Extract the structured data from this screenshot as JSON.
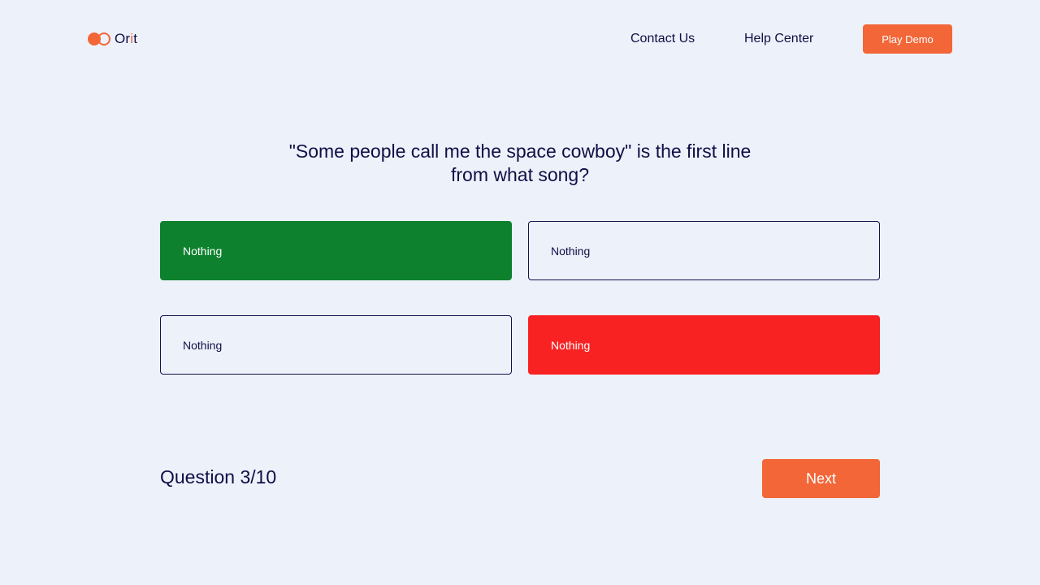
{
  "brand": {
    "name_start": "Or",
    "name_accent": "i",
    "name_end": "t",
    "accent_color": "#f26638"
  },
  "nav": {
    "contact_label": "Contact Us",
    "help_label": "Help Center",
    "demo_label": "Play Demo"
  },
  "quiz": {
    "question": "\"Some people call me the space cowboy\" is the first line from what song?",
    "options": [
      {
        "label": "Nothing",
        "state": "correct",
        "color": "#0e812f"
      },
      {
        "label": "Nothing",
        "state": "neutral"
      },
      {
        "label": "Nothing",
        "state": "neutral"
      },
      {
        "label": "Nothing",
        "state": "wrong",
        "color": "#f82223"
      }
    ],
    "progress_label": "Question 3/10",
    "next_label": "Next"
  }
}
